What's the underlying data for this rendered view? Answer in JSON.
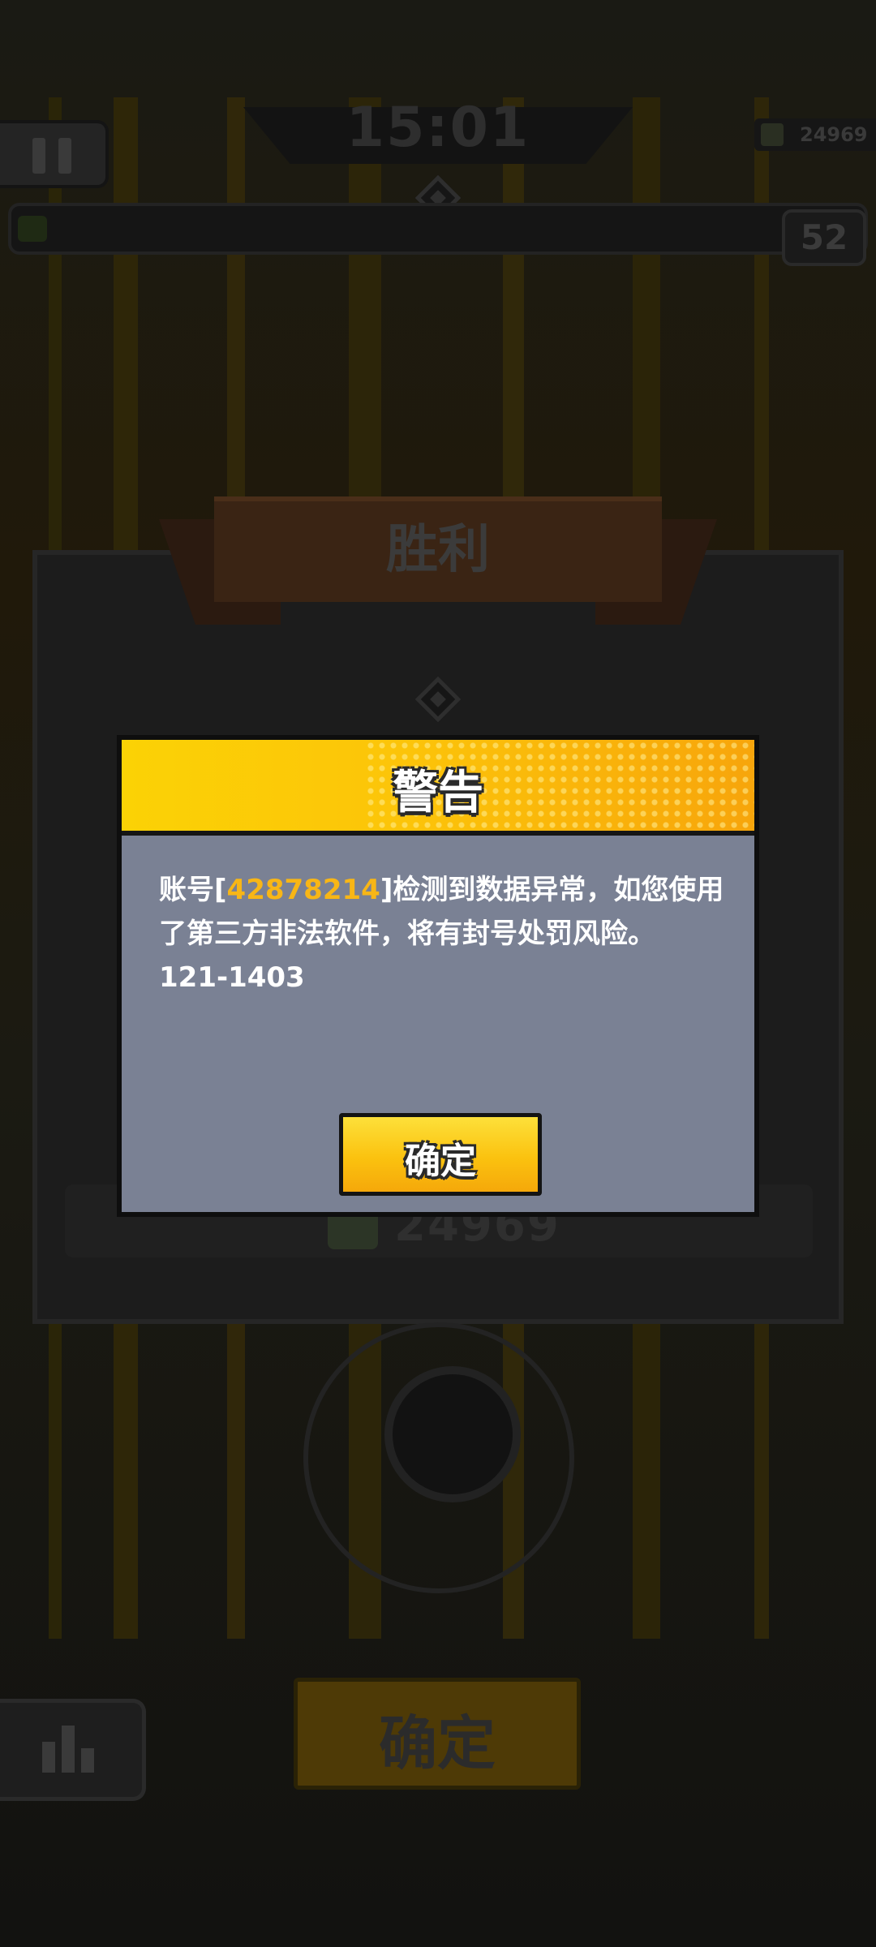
{
  "hud": {
    "timer": "15:01",
    "coins": "24969",
    "level": "52"
  },
  "victory": {
    "title": "胜利",
    "reward_value": "24969",
    "confirm_label": "确定"
  },
  "dialog": {
    "title": "警告",
    "body_prefix": "账号[",
    "account_id": "42878214",
    "body_suffix": "]检测到数据异常，如您使用了第三方非法软件，将有封号处罚风险。",
    "error_code": "121-1403",
    "confirm_label": "确定"
  },
  "colors": {
    "dialog_header_start": "#fbd205",
    "dialog_header_end": "#f7a50b",
    "dialog_body": "#7a8194",
    "account_id": "#f8b616"
  }
}
